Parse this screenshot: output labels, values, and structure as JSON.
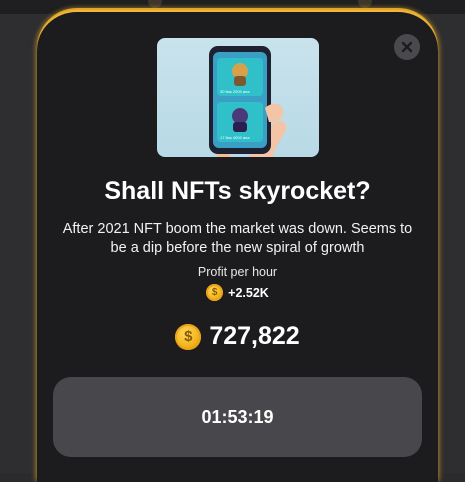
{
  "modal": {
    "title": "Shall NFTs skyrocket?",
    "description": "After 2021 NFT boom the market was down. Seems to be a dip before the new spiral of growth",
    "profit_label": "Profit per hour",
    "profit_value": "+2.52K",
    "balance": "727,822",
    "timer": "01:53:19",
    "close_icon": "close-icon",
    "coin_icon": "coin-icon",
    "hero_cards": [
      {
        "caption": "30 flas 2000 ana",
        "color": "#2fc0c9"
      },
      {
        "caption": "17 flas 4000 ana",
        "color": "#2fc0c9"
      }
    ]
  },
  "colors": {
    "sheet_bg": "#1c1c1e",
    "accent_glow": "#f0b63a",
    "button_bg": "#48484c",
    "coin": "#f3b51f"
  }
}
